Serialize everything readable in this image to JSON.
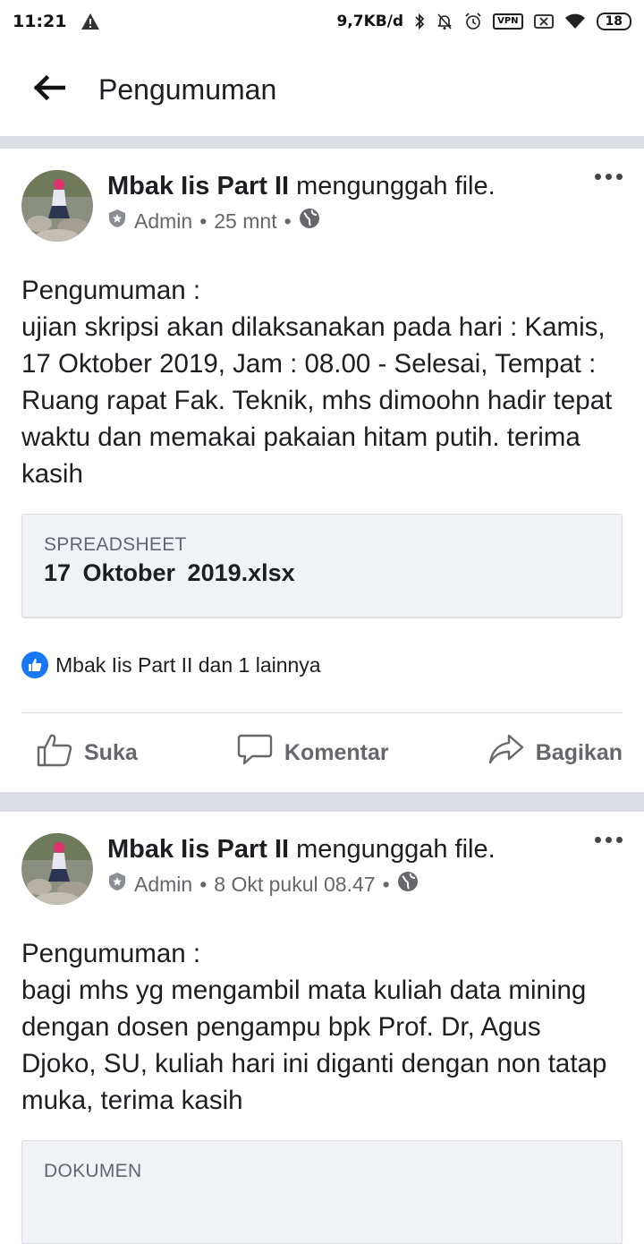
{
  "status_bar": {
    "time": "11:21",
    "net_speed": "9,7KB/d",
    "vpn": "VPN",
    "battery": "18"
  },
  "app_bar": {
    "title": "Pengumuman"
  },
  "posts": [
    {
      "author": "Mbak Iis Part II",
      "action": "mengunggah file.",
      "role": "Admin",
      "time": "25 mnt",
      "dot": "•",
      "text": "Pengumuman :\nujian skripsi akan dilaksanakan pada hari : Kamis, 17 Oktober 2019, Jam : 08.00 - Selesai, Tempat : Ruang rapat Fak. Teknik, mhs dimoohn hadir tepat waktu dan memakai pakaian hitam putih. terima kasih",
      "attachment": {
        "type": "SPREADSHEET",
        "filename": "17  Oktober  2019.xlsx"
      },
      "reactions": "Mbak Iis Part II dan 1 lainnya"
    },
    {
      "author": "Mbak Iis Part II",
      "action": "mengunggah file.",
      "role": "Admin",
      "time": "8 Okt pukul 08.47",
      "dot": "•",
      "text": "Pengumuman :\nbagi mhs yg mengambil mata kuliah data mining dengan dosen pengampu bpk Prof. Dr, Agus Djoko, SU, kuliah hari ini  diganti dengan non tatap muka, terima kasih",
      "attachment": {
        "type": "DOKUMEN"
      }
    }
  ],
  "actions": {
    "like": "Suka",
    "comment": "Komentar",
    "share": "Bagikan"
  },
  "colors": {
    "brand": "#1877f2",
    "separator": "#dadde1",
    "attachment_bg": "#f0f2f5"
  }
}
